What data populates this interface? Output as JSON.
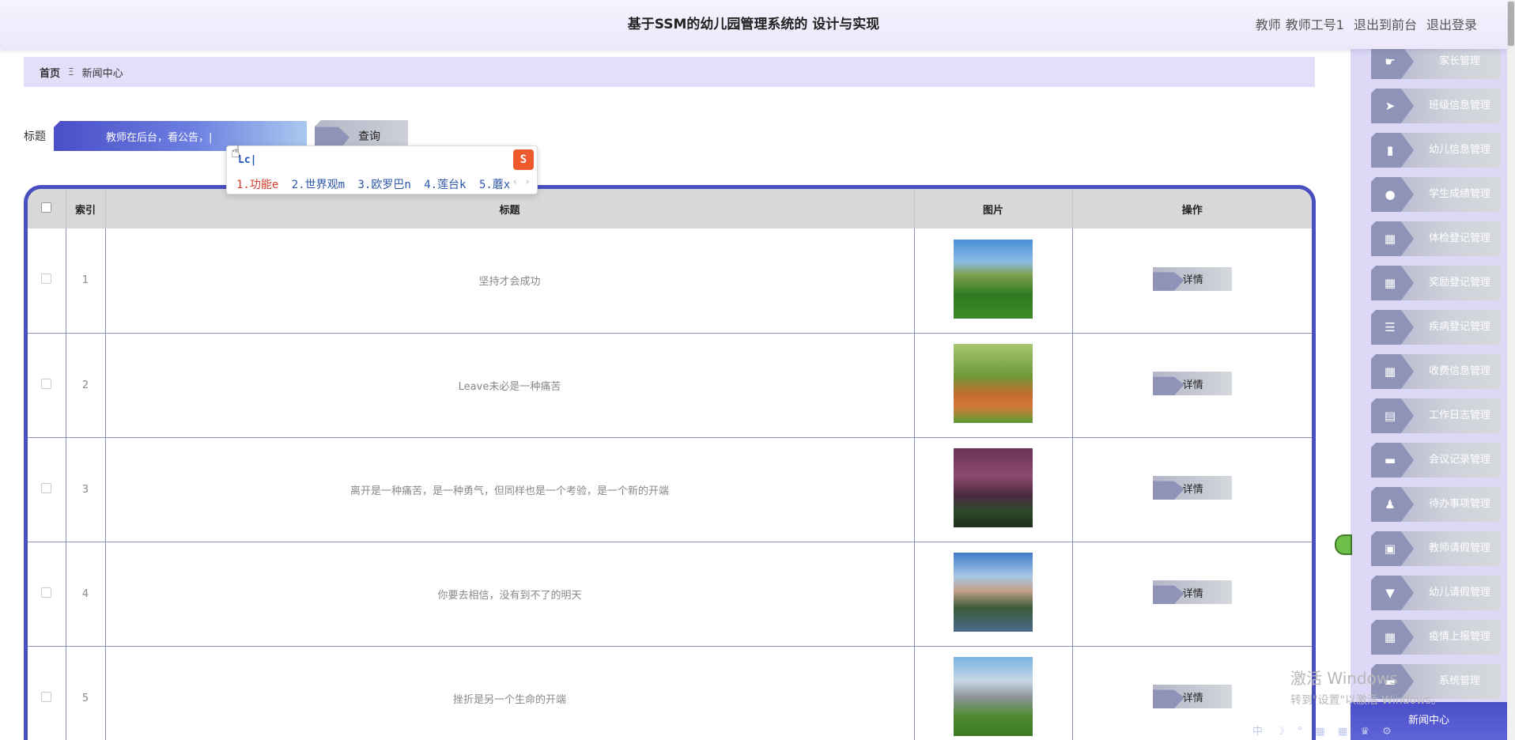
{
  "header": {
    "title": "基于SSM的幼儿园管理系统的 设计与实现",
    "role": "教师",
    "user": "教师工号1",
    "front_link": "退出到前台",
    "logout_link": "退出登录"
  },
  "breadcrumb": {
    "home": "首页",
    "separator": "Ξ",
    "current": "新闻中心"
  },
  "search": {
    "label": "标题",
    "value": "教师在后台，看公告，|",
    "button": "查询"
  },
  "ime": {
    "composition": "Lc|",
    "logo": "S",
    "candidates": [
      "1.功能e",
      "2.世界观m",
      "3.欧罗巴n",
      "4.莲台k",
      "5.蘑x"
    ],
    "arrows": "‹ ›"
  },
  "table": {
    "columns": [
      "",
      "索引",
      "标题",
      "图片",
      "操作"
    ],
    "detail_label": "详情",
    "rows": [
      {
        "index": "1",
        "title": "坚持才会成功"
      },
      {
        "index": "2",
        "title": "Leave未必是一种痛苦"
      },
      {
        "index": "3",
        "title": "离开是一种痛苦，是一种勇气，但同样也是一个考验，是一个新的开端"
      },
      {
        "index": "4",
        "title": "你要去相信，没有到不了的明天"
      },
      {
        "index": "5",
        "title": "挫折是另一个生命的开端"
      }
    ]
  },
  "sidebar": {
    "items": [
      {
        "label": "家长管理",
        "icon": "thumbs-up-icon"
      },
      {
        "label": "班级信息管理",
        "icon": "paper-plane-icon"
      },
      {
        "label": "幼儿信息管理",
        "icon": "bar-chart-icon"
      },
      {
        "label": "学生成绩管理",
        "icon": "lightbulb-icon"
      },
      {
        "label": "体检登记管理",
        "icon": "grid-icon"
      },
      {
        "label": "奖励登记管理",
        "icon": "grid-icon"
      },
      {
        "label": "疾病登记管理",
        "icon": "list-icon"
      },
      {
        "label": "收费信息管理",
        "icon": "grid-icon"
      },
      {
        "label": "工作日志管理",
        "icon": "table-icon"
      },
      {
        "label": "会议记录管理",
        "icon": "printer-icon"
      },
      {
        "label": "待办事项管理",
        "icon": "user-icon"
      },
      {
        "label": "教师请假管理",
        "icon": "clipboard-icon"
      },
      {
        "label": "幼儿请假管理",
        "icon": "stamp-icon"
      },
      {
        "label": "疫情上报管理",
        "icon": "grid-icon"
      },
      {
        "label": "系统管理",
        "icon": "folder-icon"
      }
    ],
    "active": "新闻中心"
  },
  "watermark": {
    "line1": "激活 Windows",
    "line2": "转到\"设置\"以激活 Windows。"
  },
  "tray": "中 ☽ ° ▦ ▦ ♛ ⚙"
}
